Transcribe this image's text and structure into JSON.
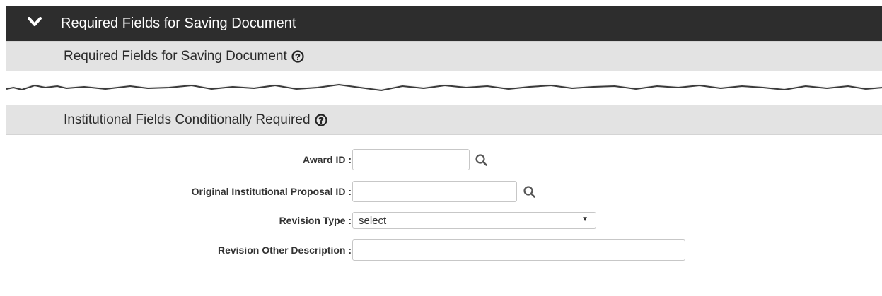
{
  "panel": {
    "title": "Required Fields for Saving Document",
    "expand_icon": "chevron-down-icon"
  },
  "sections": {
    "required": {
      "title": "Required Fields for Saving Document",
      "help_icon": "help-circle-icon"
    },
    "institutional": {
      "title": "Institutional Fields Conditionally Required",
      "help_icon": "help-circle-icon"
    }
  },
  "fields": {
    "award_id": {
      "label": "Award ID :",
      "value": "",
      "lookup_icon": "search-icon"
    },
    "original_ip_id": {
      "label": "Original Institutional Proposal ID :",
      "value": "",
      "lookup_icon": "search-icon"
    },
    "revision_type": {
      "label": "Revision Type :",
      "selected": "select"
    },
    "revision_other_description": {
      "label": "Revision Other Description :",
      "value": ""
    }
  },
  "colors": {
    "header_bg": "#2d2d2d",
    "subsection_bg": "#e3e3e3",
    "label_text": "#333333"
  }
}
